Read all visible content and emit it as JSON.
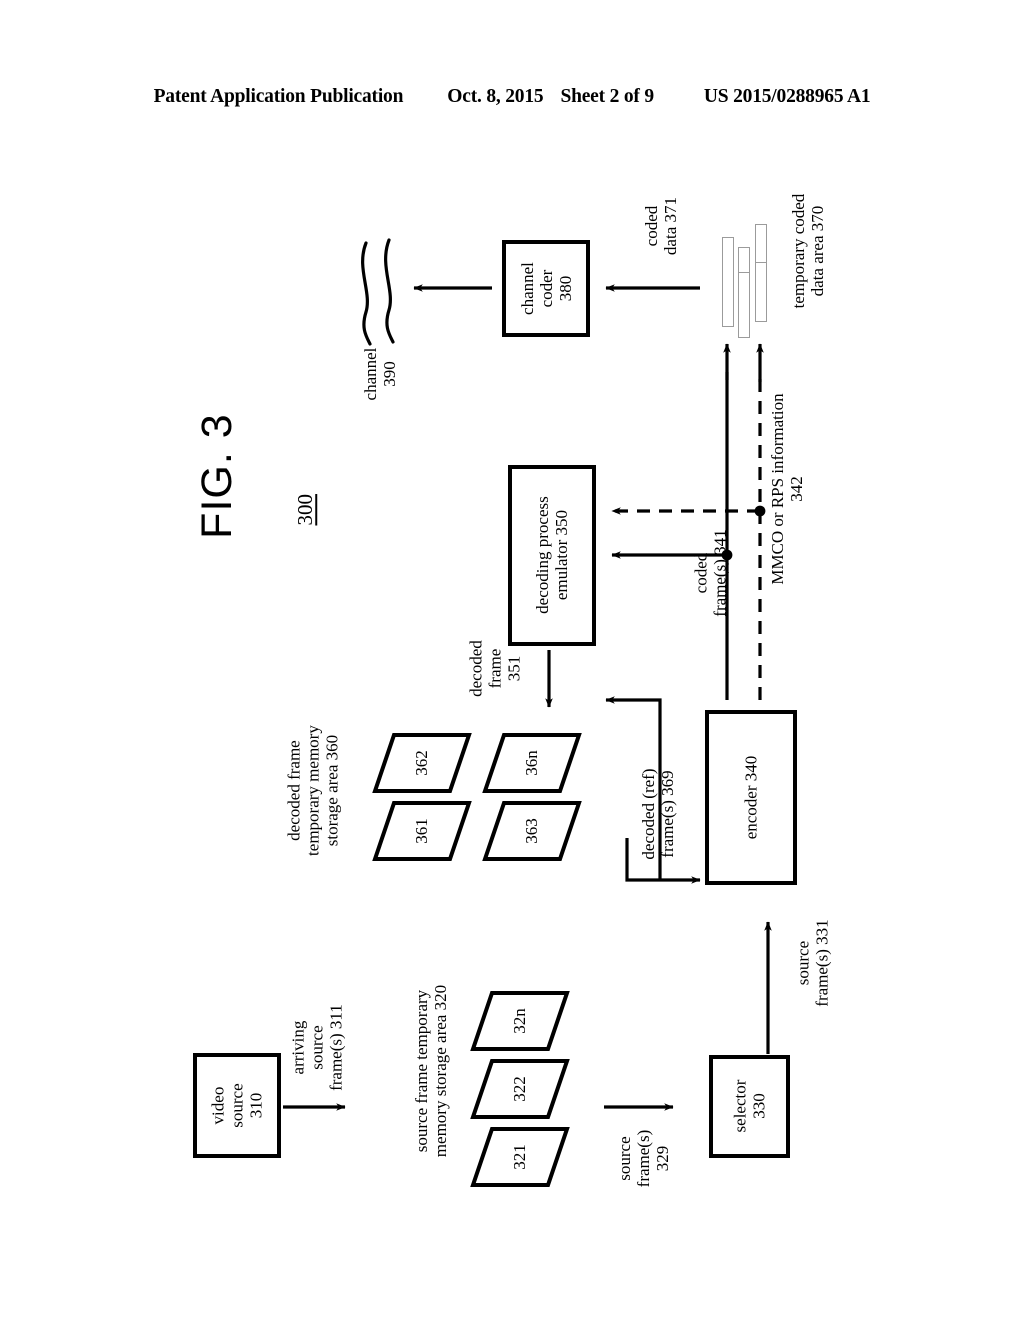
{
  "header": {
    "publication": "Patent Application Publication",
    "date": "Oct. 8, 2015",
    "sheet": "Sheet 2 of 9",
    "patent_number": "US 2015/0288965 A1"
  },
  "figure": {
    "title": "FIG. 3",
    "reference_numeral": "300",
    "blocks": {
      "video_source": "video\nsource\n310",
      "video_source_line1": "video",
      "video_source_line2": "source",
      "video_source_line3": "310",
      "selector_line1": "selector",
      "selector_line2": "330",
      "encoder": "encoder 340",
      "decoding_emulator_line1": "decoding process",
      "decoding_emulator_line2": "emulator 350",
      "channel_coder_line1": "channel",
      "channel_coder_line2": "coder",
      "channel_coder_line3": "380"
    },
    "storage_areas": {
      "source_area_line1": "source frame temporary",
      "source_area_line2": "memory storage area 320",
      "decoded_area_line1": "decoded frame",
      "decoded_area_line2": "temporary memory",
      "decoded_area_line3": "storage area 360",
      "coded_area_line1": "temporary coded",
      "coded_area_line2": "data area 370"
    },
    "frames": {
      "source_321": "321",
      "source_322": "322",
      "source_32n": "32n",
      "decoded_361": "361",
      "decoded_362": "362",
      "decoded_363": "363",
      "decoded_36n": "36n"
    },
    "flow_labels": {
      "arriving_source_frames_l1": "arriving",
      "arriving_source_frames_l2": "source",
      "arriving_source_frames_l3": "frame(s) 311",
      "source_frames_329_l1": "source",
      "source_frames_329_l2": "frame(s)",
      "source_frames_329_l3": "329",
      "source_frames_331_l1": "source",
      "source_frames_331_l2": "frame(s) 331",
      "decoded_ref_frames_369_l1": "decoded (ref)",
      "decoded_ref_frames_369_l2": "frame(s) 369",
      "decoded_frame_351_l1": "decoded",
      "decoded_frame_351_l2": "frame",
      "decoded_frame_351_l3": "351",
      "coded_frames_341_l1": "coded",
      "coded_frames_341_l2": "frame(s) 341",
      "mmco_rps_342_l1": "MMCO or RPS information",
      "mmco_rps_342_l2": "342",
      "coded_data_371_l1": "coded",
      "coded_data_371_l2": "data 371",
      "channel_390_l1": "channel",
      "channel_390_l2": "390"
    },
    "colors": {
      "stroke": "#000000",
      "gray_bar": "#9b9b9b",
      "background": "#ffffff"
    }
  }
}
